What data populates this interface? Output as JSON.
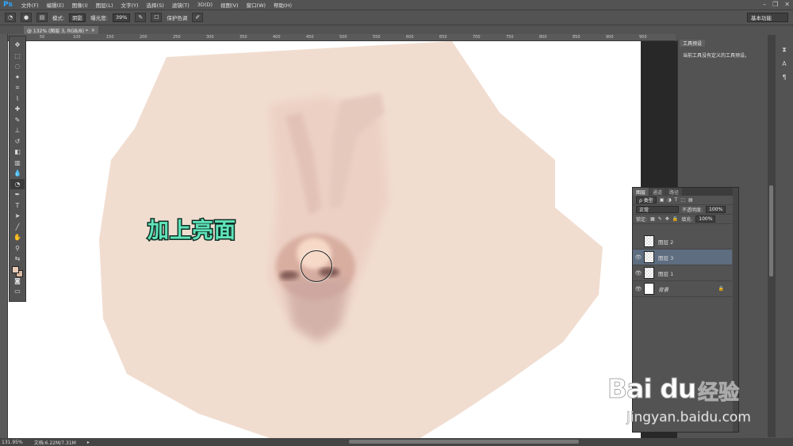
{
  "app": {
    "logo": "Ps"
  },
  "menu": [
    "文件(F)",
    "编辑(E)",
    "图像(I)",
    "图层(L)",
    "文字(Y)",
    "选择(S)",
    "滤镜(T)",
    "3D(D)",
    "视图(V)",
    "窗口(W)",
    "帮助(H)"
  ],
  "options": {
    "mode_label": "模式:",
    "mode_value": "阴影",
    "exposure_label": "曝光度:",
    "exposure_value": "39%",
    "protect_tones_label": "保护色调",
    "workspace": "基本功能"
  },
  "document": {
    "tab_title": "@ 132% (图层 3, RGB/8) *"
  },
  "ruler": {
    "ticks": [
      "50",
      "100",
      "150",
      "200",
      "250",
      "300",
      "350",
      "400",
      "450",
      "500",
      "550",
      "600",
      "650",
      "700",
      "750",
      "800",
      "850",
      "900",
      "950"
    ]
  },
  "canvas": {
    "annotation": "加上亮面"
  },
  "colors": {
    "foreground": "#e9ccb8",
    "background": "#d9b8a2",
    "skin": "#f2ddd0",
    "annotation": "#5fe3b8"
  },
  "tool_presets": {
    "tab": "工具预设",
    "message": "当前工具没有定义的工具预设。"
  },
  "layers_panel": {
    "tabs": [
      "图层",
      "通道",
      "路径"
    ],
    "filter_label": "ρ 类型",
    "blend_mode": "正常",
    "opacity_label": "不透明度:",
    "opacity_value": "100%",
    "lock_label": "锁定:",
    "fill_label": "填充:",
    "fill_value": "100%",
    "layers": [
      {
        "name": "图层 2",
        "visible": false,
        "selected": false
      },
      {
        "name": "图层 3",
        "visible": true,
        "selected": true
      },
      {
        "name": "图层 1",
        "visible": true,
        "selected": false
      },
      {
        "name": "背景",
        "visible": true,
        "selected": false
      }
    ]
  },
  "status": {
    "zoom": "131.95%",
    "doc_info": "文档:6.22M/7.31M"
  },
  "watermark": {
    "logo": "Bai du",
    "cn": "经验",
    "url": "jingyan.baidu.com"
  }
}
